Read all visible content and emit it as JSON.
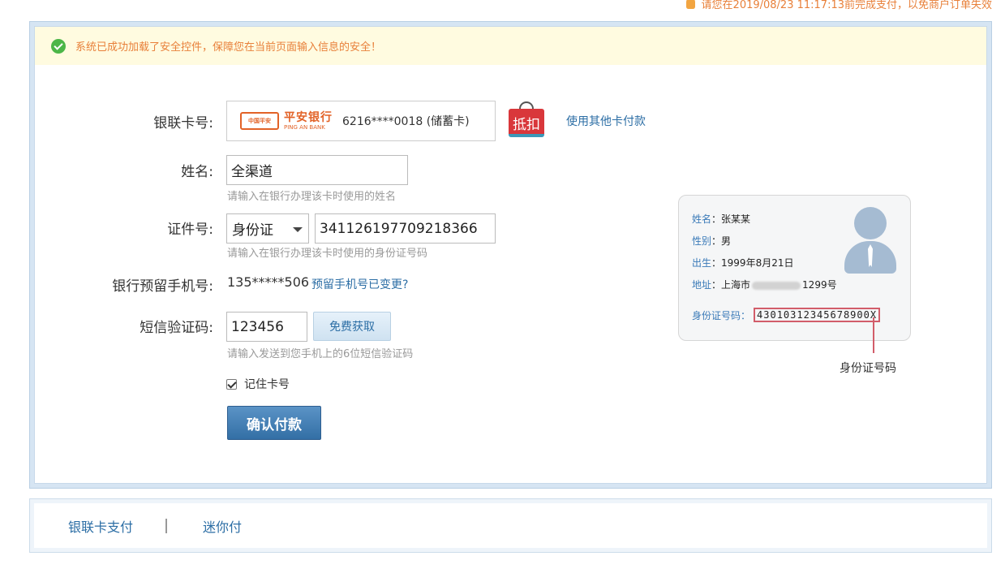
{
  "deadline_text": "请您在2019/08/23 11:17:13前完成支付，以免商户订单失效",
  "notice": "系统已成功加载了安全控件，保障您在当前页面输入信息的安全！",
  "card": {
    "label": "银联卡号:",
    "bank_name_cn": "平安银行",
    "bank_name_en": "PING AN BANK",
    "bank_mark": "中国平安",
    "number": "6216****0018 (储蓄卡)",
    "discount_tag": "抵扣",
    "other_card_link": "使用其他卡付款"
  },
  "name": {
    "label": "姓名:",
    "value": "全渠道",
    "hint": "请输入在银行办理该卡时使用的姓名"
  },
  "id": {
    "label": "证件号:",
    "type_selected": "身份证",
    "value": "341126197709218366",
    "hint": "请输入在银行办理该卡时使用的身份证号码"
  },
  "phone": {
    "label": "银行预留手机号:",
    "value": "135*****506",
    "change_link": "预留手机号已变更?"
  },
  "sms": {
    "label": "短信验证码:",
    "value": "123456",
    "get_button": "免费获取",
    "hint": "请输入发送到您手机上的6位短信验证码"
  },
  "remember_label": "记住卡号",
  "confirm_button": "确认付款",
  "id_sample": {
    "name_key": "姓名",
    "name_val": "张某某",
    "gender_key": "性别",
    "gender_val": "男",
    "birth_key": "出生",
    "birth_val": "1999年8月21日",
    "addr_key": "地址",
    "addr_prefix": "上海市",
    "addr_suffix": "1299号",
    "idno_key": "身份证号码",
    "idno_val": "43010312345678900X",
    "caption": "身份证号码"
  },
  "bottom_tabs": [
    "银联卡支付",
    "迷你付"
  ]
}
